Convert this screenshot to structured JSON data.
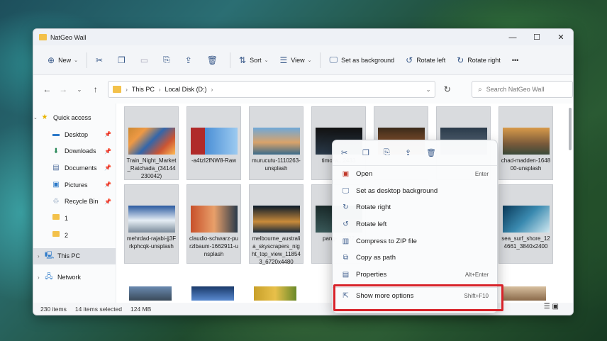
{
  "window": {
    "title": "NatGeo Wall",
    "minimize": "—",
    "maximize": "☐",
    "close": "✕"
  },
  "toolbar": {
    "new": "New",
    "sort": "Sort",
    "view": "View",
    "set_bg": "Set as background",
    "rotate_left": "Rotate left",
    "rotate_right": "Rotate right",
    "more": "•••"
  },
  "address": {
    "crumbs": [
      "This PC",
      "Local Disk (D:)"
    ],
    "search_placeholder": "Search NatGeo Wall"
  },
  "sidebar": {
    "quick_access": "Quick access",
    "items": [
      "Desktop",
      "Downloads",
      "Documents",
      "Pictures",
      "Recycle Bin",
      "1",
      "2"
    ],
    "this_pc": "This PC",
    "network": "Network"
  },
  "files": {
    "row1": [
      "Train_Night_Market_Ratchada_(34144230042)",
      "-a4tzI2fNW8-Raw",
      "murucutu-1110263-unsplash",
      "timo-w...2433",
      "",
      "",
      "chad-madden-164800-unsplash"
    ],
    "row2": [
      "mehrdad-rajabi-jj3Frkphcqk-unsplash",
      "claudio-schwarz-purzlbaum-1662911-unsplash",
      "melbourne_australia_skyscrapers_night_top_view_118543_6720x4480",
      "pang-...7927",
      "sea_surf_shore_124661_3840x2400"
    ]
  },
  "context_menu": {
    "items": [
      {
        "label": "Open",
        "shortcut": "Enter",
        "icon": "image-icon"
      },
      {
        "label": "Set as desktop background",
        "shortcut": "",
        "icon": "desktop-icon"
      },
      {
        "label": "Rotate right",
        "shortcut": "",
        "icon": "rotate-right-icon"
      },
      {
        "label": "Rotate left",
        "shortcut": "",
        "icon": "rotate-left-icon"
      },
      {
        "label": "Compress to ZIP file",
        "shortcut": "",
        "icon": "zip-icon"
      },
      {
        "label": "Copy as path",
        "shortcut": "",
        "icon": "path-icon"
      },
      {
        "label": "Properties",
        "shortcut": "Alt+Enter",
        "icon": "properties-icon"
      }
    ],
    "more": {
      "label": "Show more options",
      "shortcut": "Shift+F10"
    }
  },
  "status": {
    "count": "230 items",
    "selected": "14 items selected",
    "size": "124 MB"
  },
  "colors": {
    "highlight": "#d8232a",
    "folder": "#f3c14a",
    "selected": "#dcdfe4"
  }
}
